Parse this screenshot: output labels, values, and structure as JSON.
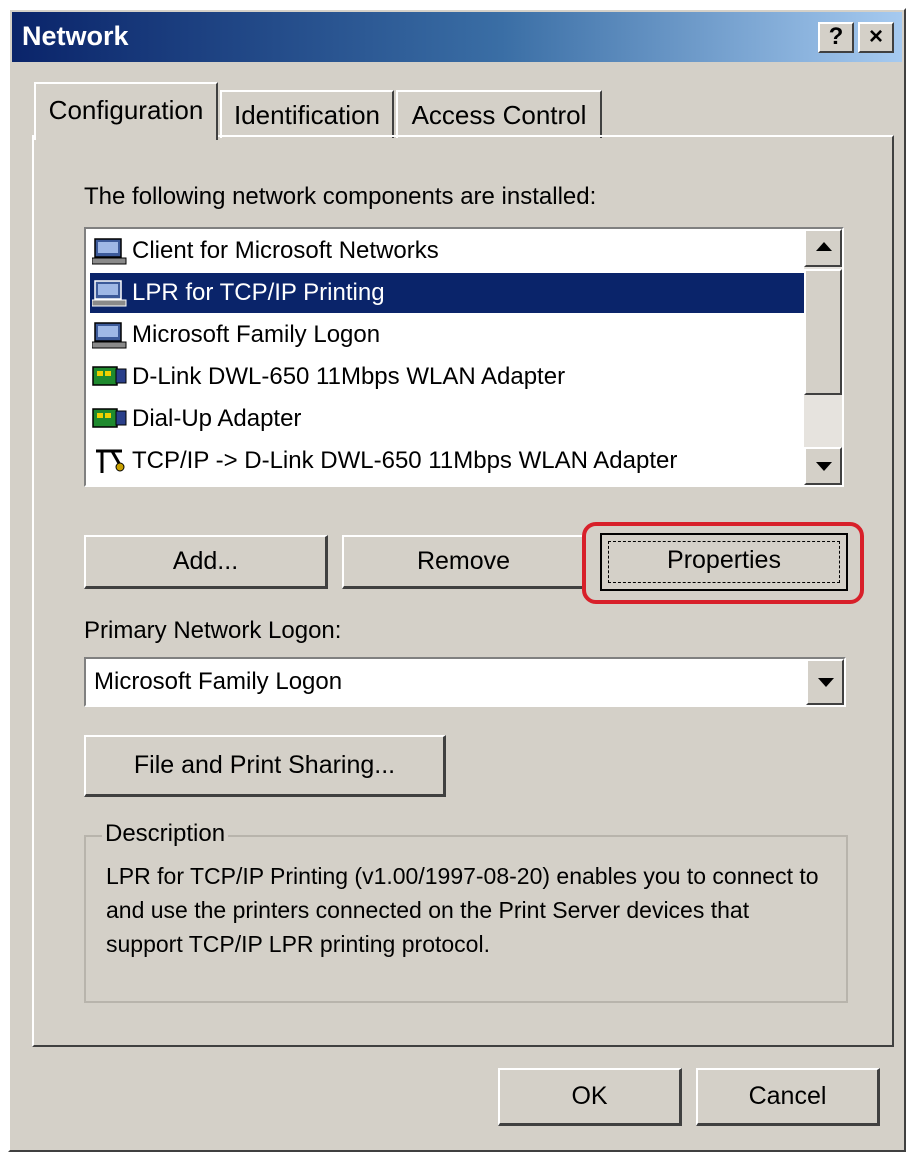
{
  "window": {
    "title": "Network",
    "help_label": "?",
    "close_label": "×"
  },
  "tabs": [
    {
      "label": "Configuration",
      "active": true
    },
    {
      "label": "Identification",
      "active": false
    },
    {
      "label": "Access Control",
      "active": false
    }
  ],
  "components": {
    "heading": "The following network components are installed:",
    "items": [
      {
        "label": "Client for Microsoft Networks",
        "icon": "client-icon",
        "selected": false
      },
      {
        "label": "LPR for TCP/IP Printing",
        "icon": "client-icon",
        "selected": true
      },
      {
        "label": "Microsoft Family Logon",
        "icon": "client-icon",
        "selected": false
      },
      {
        "label": "D-Link DWL-650 11Mbps WLAN Adapter",
        "icon": "adapter-icon",
        "selected": false
      },
      {
        "label": "Dial-Up Adapter",
        "icon": "adapter-icon",
        "selected": false
      },
      {
        "label": "TCP/IP -> D-Link DWL-650 11Mbps WLAN Adapter",
        "icon": "protocol-icon",
        "selected": false
      }
    ]
  },
  "buttons": {
    "add": "Add...",
    "remove": "Remove",
    "properties": "Properties",
    "file_print_sharing": "File and Print Sharing...",
    "ok": "OK",
    "cancel": "Cancel"
  },
  "primary_logon": {
    "label": "Primary Network Logon:",
    "value": "Microsoft Family Logon"
  },
  "description": {
    "title": "Description",
    "text": "LPR for TCP/IP Printing (v1.00/1997-08-20) enables you to connect to and use the printers connected on the Print Server devices that support TCP/IP LPR printing protocol."
  },
  "colors": {
    "highlight_ring": "#d8202a",
    "selection": "#0a246a",
    "face": "#d4d0c8"
  }
}
